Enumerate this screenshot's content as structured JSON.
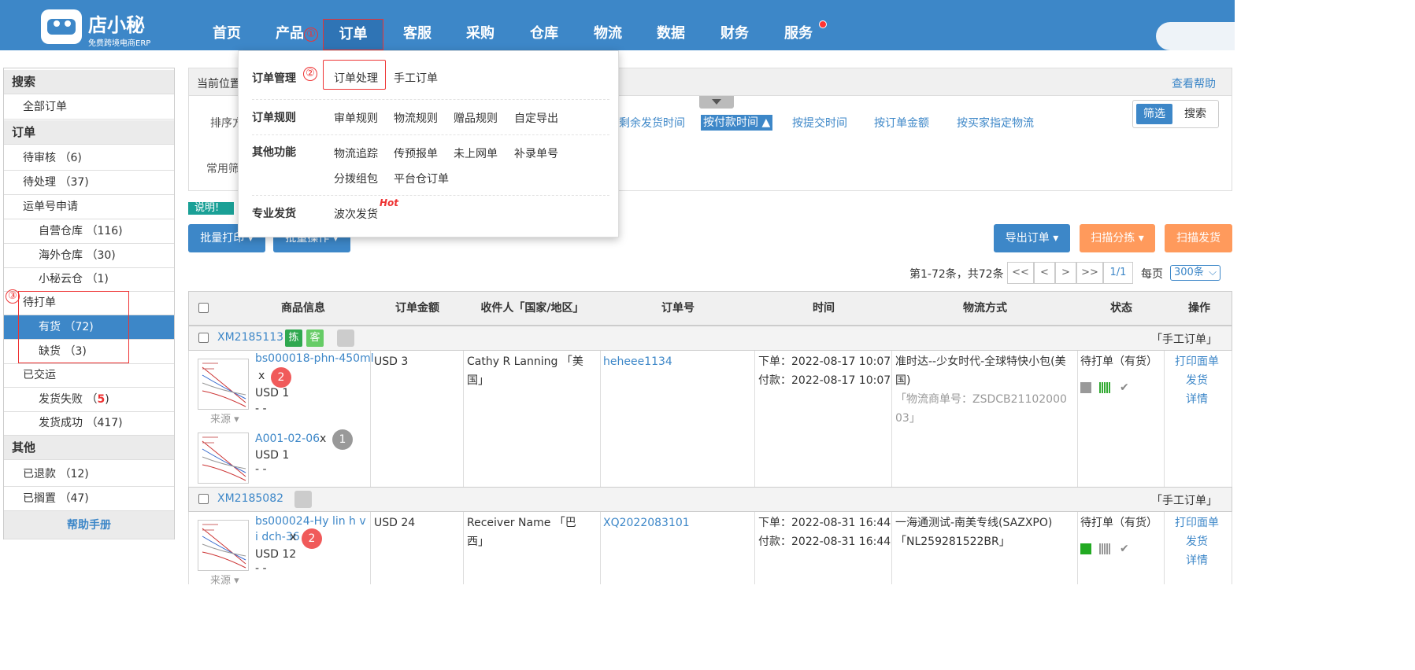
{
  "brand": {
    "name": "店小秘",
    "subtitle": "免费跨境电商ERP"
  },
  "nav": [
    "首页",
    "产品",
    "订单",
    "客服",
    "采购",
    "仓库",
    "物流",
    "数据",
    "财务",
    "服务"
  ],
  "markers": [
    "①",
    "②",
    "③"
  ],
  "dropdown": {
    "groups": [
      {
        "title": "订单管理",
        "items": [
          "订单处理",
          "手工订单"
        ]
      },
      {
        "title": "订单规则",
        "items": [
          "审单规则",
          "物流规则",
          "赠品规则",
          "自定导出"
        ]
      },
      {
        "title": "其他功能",
        "items": [
          "物流追踪",
          "传预报单",
          "未上网单",
          "补录单号",
          "分拨组包",
          "平台仓订单"
        ]
      },
      {
        "title": "专业发货",
        "items": [
          "波次发货"
        ]
      }
    ],
    "hot": "Hot"
  },
  "sidebar": {
    "search_head": "搜索",
    "all_orders": "全部订单",
    "order_head": "订单",
    "pending_review": "待审核 （6)",
    "processing": "待处理 （37)",
    "tracking_apply": "运单号申请",
    "own_warehouse": "自营仓库 （116)",
    "overseas_warehouse": "海外仓库 （30)",
    "cloud_warehouse": "小秘云仓 （1)",
    "to_print": "待打单",
    "in_stock": "有货 （72)",
    "out_stock": "缺货 （3)",
    "shipped": "已交运",
    "ship_fail_label": "发货失败 （",
    "ship_fail_count": "5",
    "ship_fail_end": ")",
    "ship_ok": "发货成功 （417)",
    "other_head": "其他",
    "refunded": "已退款 （12)",
    "shelved": "已搁置 （47)",
    "help": "帮助手册"
  },
  "crumb": {
    "current": "当前位置",
    "help": "查看帮助"
  },
  "filter": {
    "sort_label": "排序方",
    "sort_options": [
      "剩余发货时间",
      "按付款时间 ▲",
      "按提交时间",
      "按订单金额",
      "按买家指定物流"
    ],
    "common_label": "常用筛",
    "btn_filter": "筛选",
    "btn_search": "搜索",
    "note": "说明!"
  },
  "actions": {
    "batch_print": "批量打印 ▾",
    "batch_ops": "批量操作 ▾",
    "export": "导出订单 ▾",
    "scan_sort": "扫描分拣 ▾",
    "scan_ship": "扫描发货"
  },
  "pager": {
    "summary": "第1-72条，共72条",
    "first": "<<",
    "prev": "<",
    "next": ">",
    "last": ">>",
    "page": "1/1",
    "per_page_label": "每页",
    "per_page": "300条"
  },
  "table": {
    "headers": [
      "商品信息",
      "订单金额",
      "收件人「国家/地区」",
      "订单号",
      "时间",
      "物流方式",
      "状态",
      "操作"
    ],
    "orders": [
      {
        "id": "XM2185113",
        "tags": [
          "拣",
          "客"
        ],
        "type": "「手工订单」",
        "items": [
          {
            "sku": "bs000018-phn-450ml",
            "qty": "2",
            "price": "USD 1",
            "dash": "- -",
            "src": "来源 ▾"
          },
          {
            "sku": "A001-02-06",
            "qty": "1",
            "price": "USD 1",
            "dash": "- -"
          }
        ],
        "amount": "USD 3",
        "recipient": "Cathy R Lanning 「美国」",
        "order_no": "heheee1134",
        "placed": "下单：2022-08-17 10:07",
        "paid": "付款：2022-08-17 10:07",
        "logistics": "准时达--少女时代-全球特快小包(美国)",
        "logistics_no": "「物流商单号：ZSDCB2110200003」",
        "status": "待打单（有货）",
        "ops": [
          "打印面单",
          "发货",
          "详情"
        ]
      },
      {
        "id": "XM2185082",
        "tags": [],
        "type": "「手工订单」",
        "items": [
          {
            "sku": "bs000024-Hy lin h vi dch-36",
            "qty": "2",
            "price": "USD 12",
            "dash": "- -",
            "src": "来源 ▾"
          }
        ],
        "amount": "USD 24",
        "recipient": "Receiver Name 「巴西」",
        "order_no": "XQ2022083101",
        "placed": "下单：2022-08-31 16:44",
        "paid": "付款：2022-08-31 16:44",
        "logistics": "一海通测试-南美专线(SAZXPO)",
        "logistics_no": "「NL259281522BR」",
        "status": "待打单（有货）",
        "ops": [
          "打印面单",
          "发货",
          "详情"
        ]
      }
    ],
    "x": "x"
  },
  "colors": {
    "brand_blue": "#3d87c8",
    "red": "#e33",
    "orange": "#ff9a5c",
    "green": "#4caf50"
  }
}
